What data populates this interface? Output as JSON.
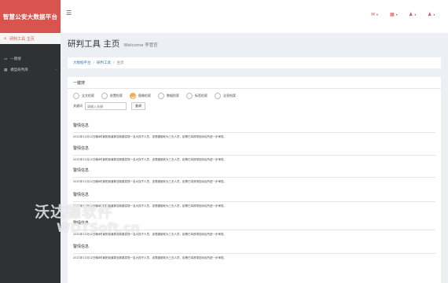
{
  "app": {
    "logo_text": "智慧公安大数据平台"
  },
  "topbar": {
    "menu_icon": "hamburger-icon",
    "icons": [
      "mail-icon",
      "notification-icon",
      "user-icon",
      "user-menu-icon"
    ],
    "accent": "#d9534f"
  },
  "sidebar": {
    "active": {
      "label": "研判工具 主页",
      "icon": "home-icon"
    },
    "items": [
      {
        "label": "一键搜",
        "icon": "monitor-icon"
      },
      {
        "label": "模型研判库",
        "icon": "grid-icon"
      }
    ]
  },
  "header": {
    "title": "研判工具 主页",
    "subtitle": "Welcome 李管官"
  },
  "breadcrumb": [
    "大数据平台",
    "研判工具",
    "主页"
  ],
  "search": {
    "title": "一键搜",
    "radios": [
      "全文检索",
      "前置检索",
      "图像检索",
      "数据检索",
      "标签检索",
      "全息档案"
    ],
    "checked_index": 2,
    "keyword_label": "关键词",
    "placeholder": "请输入关键",
    "button_label": "查询"
  },
  "alerts": [
    {
      "title": "警情信息",
      "text": "2021年11月12日晚8时景阳街道郭亚新路发现一名大拐子人员，该男腿被砍为三无人员，民警已将其带回派出所进一步审查。"
    },
    {
      "title": "警情信息",
      "text": "2021年11月12日晚8时景阳街道郭亚新路发现一名大拐子人员，该男腿被砍为三无人员，民警已将其带回派出所进一步审查。"
    },
    {
      "title": "警情信息",
      "text": "2021年11月12日晚8时景阳街道郭亚新路发现一名大拐子人员，该男腿被砍为三无人员，民警已将其带回派出所进一步审查。"
    },
    {
      "title": "警情信息",
      "text": "2021年11月12日晚8时景阳街道郭亚新路发现一名大拐子人员，该男腿被砍为三无人员，民警已将其带回派出所进一步审查。"
    },
    {
      "title": "警情信息",
      "text": "2021年11月12日晚8时景阳街道郭亚新路发现一名大拐子人员，该男腿被砍为三无人员，民警已将其带回派出所进一步审查。"
    },
    {
      "title": "警情信息",
      "text": "2021年11月12日晚8时景阳街道郭亚新路发现一名大拐子人员，该男腿被砍为三无人员，民警已将其带回派出所进一步审查。"
    }
  ],
  "watermark": {
    "cn": "沃达德软件",
    "en": "WDTSoft.cn"
  }
}
